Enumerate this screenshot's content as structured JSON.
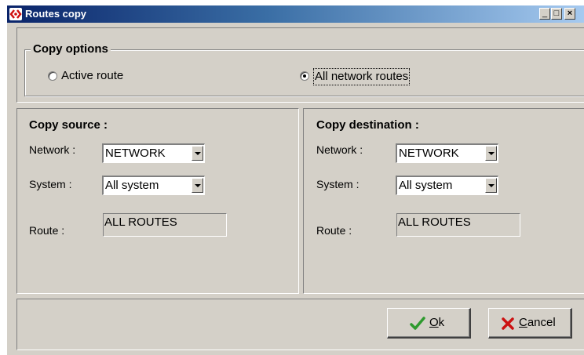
{
  "window": {
    "title": "Routes copy",
    "controls": {
      "minimize": "_",
      "maximize": "□",
      "close": "×"
    }
  },
  "copy_options": {
    "legend": "Copy options",
    "options": [
      {
        "label": "Active route",
        "checked": false
      },
      {
        "label": "All network routes",
        "checked": true
      }
    ]
  },
  "copy_source": {
    "title": "Copy source :",
    "network_label": "Network :",
    "network_value": "NETWORK",
    "system_label": "System :",
    "system_value": "All system",
    "route_label": "Route :",
    "route_value": "ALL ROUTES"
  },
  "copy_destination": {
    "title": "Copy destination :",
    "network_label": "Network :",
    "network_value": "NETWORK",
    "system_label": "System :",
    "system_value": "All system",
    "route_label": "Route :",
    "route_value": "ALL ROUTES"
  },
  "buttons": {
    "ok_accel": "O",
    "ok_rest": "k",
    "cancel_accel": "C",
    "cancel_rest": "ancel"
  },
  "colors": {
    "face": "#d4d0c8",
    "titlebar_start": "#0a246a",
    "ok_check": "#2e9a2e",
    "cancel_x": "#cc1111"
  }
}
